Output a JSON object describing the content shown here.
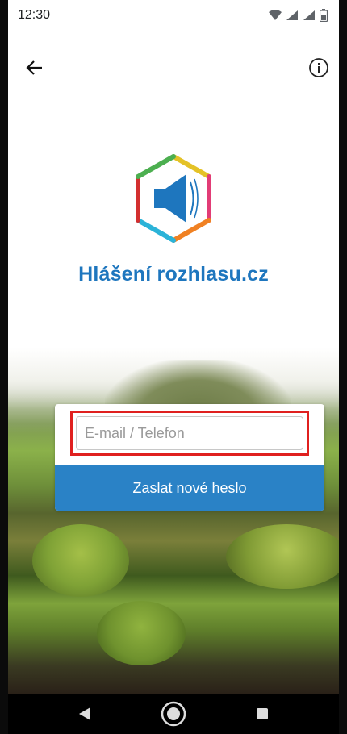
{
  "status_bar": {
    "time": "12:30",
    "icons": [
      "wifi-icon",
      "signal-roaming-icon",
      "signal-icon",
      "battery-icon"
    ]
  },
  "app_bar": {
    "back_icon": "arrow-left-icon",
    "info_icon": "info-icon"
  },
  "app": {
    "title": "Hlášení rozhlasu.cz",
    "title_color": "#1e76be"
  },
  "form": {
    "email_placeholder": "E-mail / Telefon",
    "email_value": "",
    "submit_label": "Zaslat nové heslo",
    "submit_color": "#2a82c6",
    "highlight_color": "#e0201f"
  },
  "nav": {
    "back_icon": "back-triangle-icon",
    "home_icon": "home-circle-icon",
    "recents_icon": "recents-square-icon"
  }
}
